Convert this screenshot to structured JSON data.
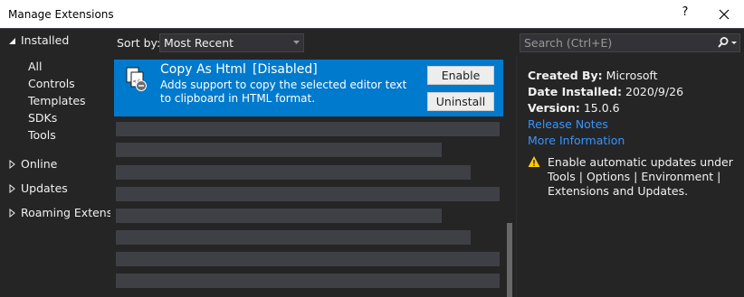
{
  "window": {
    "title": "Manage Extensions",
    "help_glyph": "?"
  },
  "tree": {
    "installed": "Installed",
    "installed_children": [
      "All",
      "Controls",
      "Templates",
      "SDKs",
      "Tools"
    ],
    "online": "Online",
    "updates": "Updates",
    "roaming": "Roaming Extensions"
  },
  "sort": {
    "label": "Sort by:",
    "value": "Most Recent"
  },
  "search": {
    "placeholder": "Search (Ctrl+E)"
  },
  "extension": {
    "name": "Copy As Html",
    "status": "[Disabled]",
    "description": "Adds support to copy the selected editor text to clipboard in HTML format.",
    "enable_label": "Enable",
    "uninstall_label": "Uninstall"
  },
  "details": {
    "created_by_label": "Created By:",
    "created_by": "Microsoft",
    "date_label": "Date Installed:",
    "date": "2020/9/26",
    "version_label": "Version:",
    "version": "15.0.6",
    "release_notes": "Release Notes",
    "more_info": "More Information",
    "warning": "Enable automatic updates under Tools | Options | Environment | Extensions and Updates."
  },
  "colors": {
    "accent": "#007acc",
    "background": "#252526",
    "link": "#3794ff",
    "warning": "#ffcc00"
  }
}
